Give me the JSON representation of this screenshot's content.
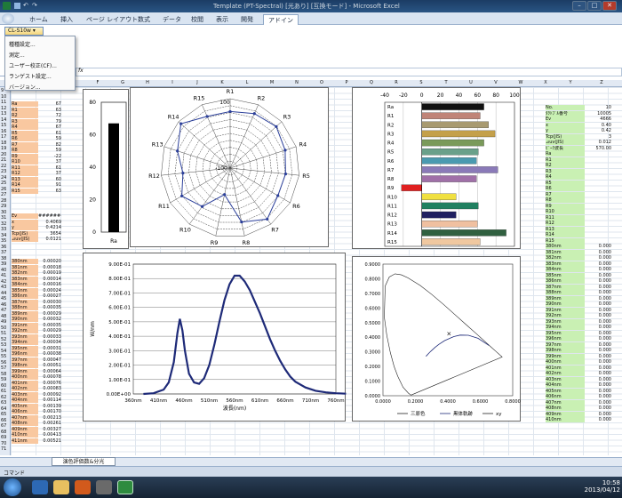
{
  "window": {
    "title": "Template (PT-Spectral) [光あり] [互換モード] - Microsoft Excel",
    "min": "–",
    "max": "□",
    "close": "✕"
  },
  "ribbon": {
    "tabs": [
      "ホーム",
      "挿入",
      "ページ レイアウト",
      "数式",
      "データ",
      "校閲",
      "表示",
      "開発",
      "アドイン"
    ],
    "active": "アドイン",
    "cl_button": "CL-S10w ▾"
  },
  "menu": {
    "items": [
      "種種設定...",
      "測定...",
      "ユーザー校正(CF)...",
      "ランゲスト設定...",
      "バージョン..."
    ]
  },
  "formula": {
    "fx": "fx"
  },
  "columns": [
    "F",
    "G",
    "H",
    "I",
    "J",
    "K",
    "L",
    "M",
    "N",
    "O",
    "P",
    "Q",
    "R",
    "S",
    "T",
    "U",
    "V",
    "W",
    "X",
    "Y",
    "Z"
  ],
  "left_table": {
    "labels": [
      "Ra",
      "R1",
      "R2",
      "R3",
      "R4",
      "R5",
      "R6",
      "R7",
      "R8",
      "R9",
      "R10",
      "R11",
      "R12",
      "R13",
      "R14",
      "R15"
    ],
    "values": [
      "67",
      "63",
      "72",
      "79",
      "67",
      "61",
      "59",
      "82",
      "59",
      "-22",
      "37",
      "61",
      "37",
      "60",
      "91",
      "63"
    ]
  },
  "colorimetric": {
    "labels": [
      "Ev",
      "x",
      "y",
      "Tcp(JIS)",
      "⊿uv(JIS)"
    ],
    "values": [
      "########",
      "0.4069",
      "0.4214",
      "3654",
      "0.0121"
    ]
  },
  "spectral": {
    "labels": [
      "380nm",
      "381nm",
      "382nm",
      "383nm",
      "384nm",
      "385nm",
      "386nm",
      "387nm",
      "388nm",
      "389nm",
      "390nm",
      "391nm",
      "392nm",
      "393nm",
      "394nm",
      "395nm",
      "396nm",
      "397nm",
      "398nm",
      "399nm",
      "400nm",
      "401nm",
      "402nm",
      "403nm",
      "404nm",
      "405nm",
      "406nm",
      "407nm",
      "408nm",
      "409nm",
      "410nm",
      "411nm"
    ],
    "values": [
      "0.00020",
      "0.00018",
      "0.00019",
      "0.00014",
      "0.00016",
      "0.00024",
      "0.00027",
      "0.00030",
      "0.00035",
      "0.00029",
      "0.00032",
      "0.00035",
      "0.00029",
      "0.00033",
      "0.00034",
      "0.00031",
      "0.00038",
      "0.00047",
      "0.00051",
      "0.00064",
      "0.00078",
      "0.00076",
      "0.00083",
      "0.00092",
      "0.00114",
      "0.00139",
      "0.00170",
      "0.00213",
      "0.00261",
      "0.00327",
      "0.00413",
      "0.00521"
    ]
  },
  "right_table": {
    "labels": [
      "No.",
      "ﾀｸﾄﾌﾞﾙ番号",
      "Ev",
      "x",
      "y",
      "Tcp(JIS)",
      "⊿uv(JIS)",
      "ﾋﾟｰｸ波長",
      "Ra",
      "R1",
      "R2",
      "R3",
      "R4",
      "R5",
      "R6",
      "R7",
      "R8",
      "R9",
      "R10",
      "R11",
      "R12",
      "R13",
      "R14",
      "R15",
      "380nm",
      "381nm",
      "382nm",
      "383nm",
      "384nm",
      "385nm",
      "386nm",
      "387nm",
      "388nm",
      "389nm",
      "390nm",
      "391nm",
      "392nm",
      "393nm",
      "394nm",
      "395nm",
      "396nm",
      "397nm",
      "398nm",
      "399nm",
      "400nm",
      "401nm",
      "402nm",
      "403nm",
      "404nm",
      "405nm",
      "406nm",
      "407nm",
      "408nm",
      "409nm",
      "410nm"
    ],
    "values": [
      "10",
      "10005",
      "4666",
      "0.40",
      "0.42",
      "3",
      "0.012",
      "570.00",
      "",
      "",
      "",
      "",
      "",
      "",
      "",
      "",
      "",
      "",
      "",
      "",
      "",
      "",
      "",
      "",
      "0.000",
      "0.000",
      "0.000",
      "0.000",
      "0.000",
      "0.000",
      "0.000",
      "0.000",
      "0.000",
      "0.000",
      "0.000",
      "0.000",
      "0.000",
      "0.000",
      "0.000",
      "0.000",
      "0.000",
      "0.000",
      "0.000",
      "0.000",
      "0.000",
      "0.000",
      "0.000",
      "0.000",
      "0.000",
      "0.000",
      "0.000",
      "0.000",
      "0.000",
      "0.000",
      "0.000"
    ]
  },
  "chart_data": [
    {
      "type": "bar",
      "categories": [
        "Ra"
      ],
      "values": [
        67
      ],
      "ylim": [
        0,
        80
      ],
      "yticks": [
        "0",
        "20",
        "40",
        "60",
        "80"
      ]
    },
    {
      "type": "radar",
      "categories": [
        "R1",
        "R2",
        "R3",
        "R4",
        "R5",
        "R6",
        "R7",
        "R8",
        "R9",
        "R10",
        "R11",
        "R12",
        "R13",
        "R14",
        "R15"
      ],
      "values": [
        63,
        72,
        79,
        67,
        61,
        59,
        82,
        59,
        -22,
        37,
        61,
        37,
        60,
        91,
        63
      ],
      "rlim": [
        -100,
        100
      ],
      "ticks": [
        "100",
        "-100"
      ]
    },
    {
      "type": "bar",
      "orientation": "horizontal",
      "categories": [
        "Ra",
        "R1",
        "R2",
        "R3",
        "R4",
        "R5",
        "R6",
        "R7",
        "R8",
        "R9",
        "R10",
        "R11",
        "R12",
        "R13",
        "R14",
        "R15"
      ],
      "values": [
        67,
        63,
        72,
        79,
        67,
        61,
        59,
        82,
        59,
        -22,
        37,
        61,
        37,
        60,
        91,
        63
      ],
      "colors": [
        "#111111",
        "#c08478",
        "#a89a70",
        "#c4a04a",
        "#7a9a5a",
        "#6aa08a",
        "#4a9ab0",
        "#8a7ab8",
        "#a070a8",
        "#e02020",
        "#f0e040",
        "#208060",
        "#202060",
        "#f0c0a0",
        "#306040",
        "#f0c8a0"
      ],
      "xlim": [
        -40,
        100
      ],
      "xticks": [
        "-40",
        "-20",
        "0",
        "20",
        "40",
        "60",
        "80",
        "100"
      ]
    },
    {
      "type": "line",
      "xlabel": "波長(nm)",
      "ylabel": "W/nm",
      "xticks": [
        "360nm",
        "410nm",
        "460nm",
        "510nm",
        "560nm",
        "610nm",
        "660nm",
        "710nm",
        "760nm"
      ],
      "yticks": [
        "0.00E+00",
        "1.00E-01",
        "2.00E-01",
        "3.00E-01",
        "4.00E-01",
        "5.00E-01",
        "6.00E-01",
        "7.00E-01",
        "8.00E-01",
        "9.00E-01"
      ],
      "ylim": [
        0,
        0.9
      ],
      "x": [
        380,
        400,
        420,
        430,
        440,
        447,
        452,
        457,
        462,
        470,
        480,
        490,
        500,
        510,
        520,
        530,
        540,
        550,
        560,
        570,
        580,
        590,
        600,
        610,
        620,
        630,
        640,
        650,
        660,
        670,
        680,
        700,
        720,
        740,
        760,
        780
      ],
      "y": [
        0,
        0.005,
        0.03,
        0.08,
        0.22,
        0.42,
        0.52,
        0.44,
        0.3,
        0.14,
        0.08,
        0.07,
        0.11,
        0.2,
        0.34,
        0.5,
        0.65,
        0.76,
        0.82,
        0.82,
        0.78,
        0.72,
        0.64,
        0.56,
        0.47,
        0.38,
        0.3,
        0.23,
        0.17,
        0.12,
        0.085,
        0.045,
        0.022,
        0.011,
        0.005,
        0.002
      ]
    },
    {
      "type": "scatter",
      "xticks": [
        "0.0000",
        "0.2000",
        "0.4000",
        "0.6000",
        "0.8000"
      ],
      "yticks": [
        "0.0000",
        "0.1000",
        "0.2000",
        "0.3000",
        "0.4000",
        "0.5000",
        "0.6000",
        "0.7000",
        "0.8000",
        "0.9000"
      ],
      "xlim": [
        0,
        0.8
      ],
      "ylim": [
        0,
        0.9
      ],
      "point": {
        "x": 0.4069,
        "y": 0.4214
      },
      "legend": [
        "三原色",
        "黒体軌跡",
        "xy"
      ]
    }
  ],
  "sheet": {
    "tab": "演色評価数&分光",
    "command": "コマンド"
  },
  "clock": {
    "time": "10:58",
    "date": "2013/04/12"
  }
}
